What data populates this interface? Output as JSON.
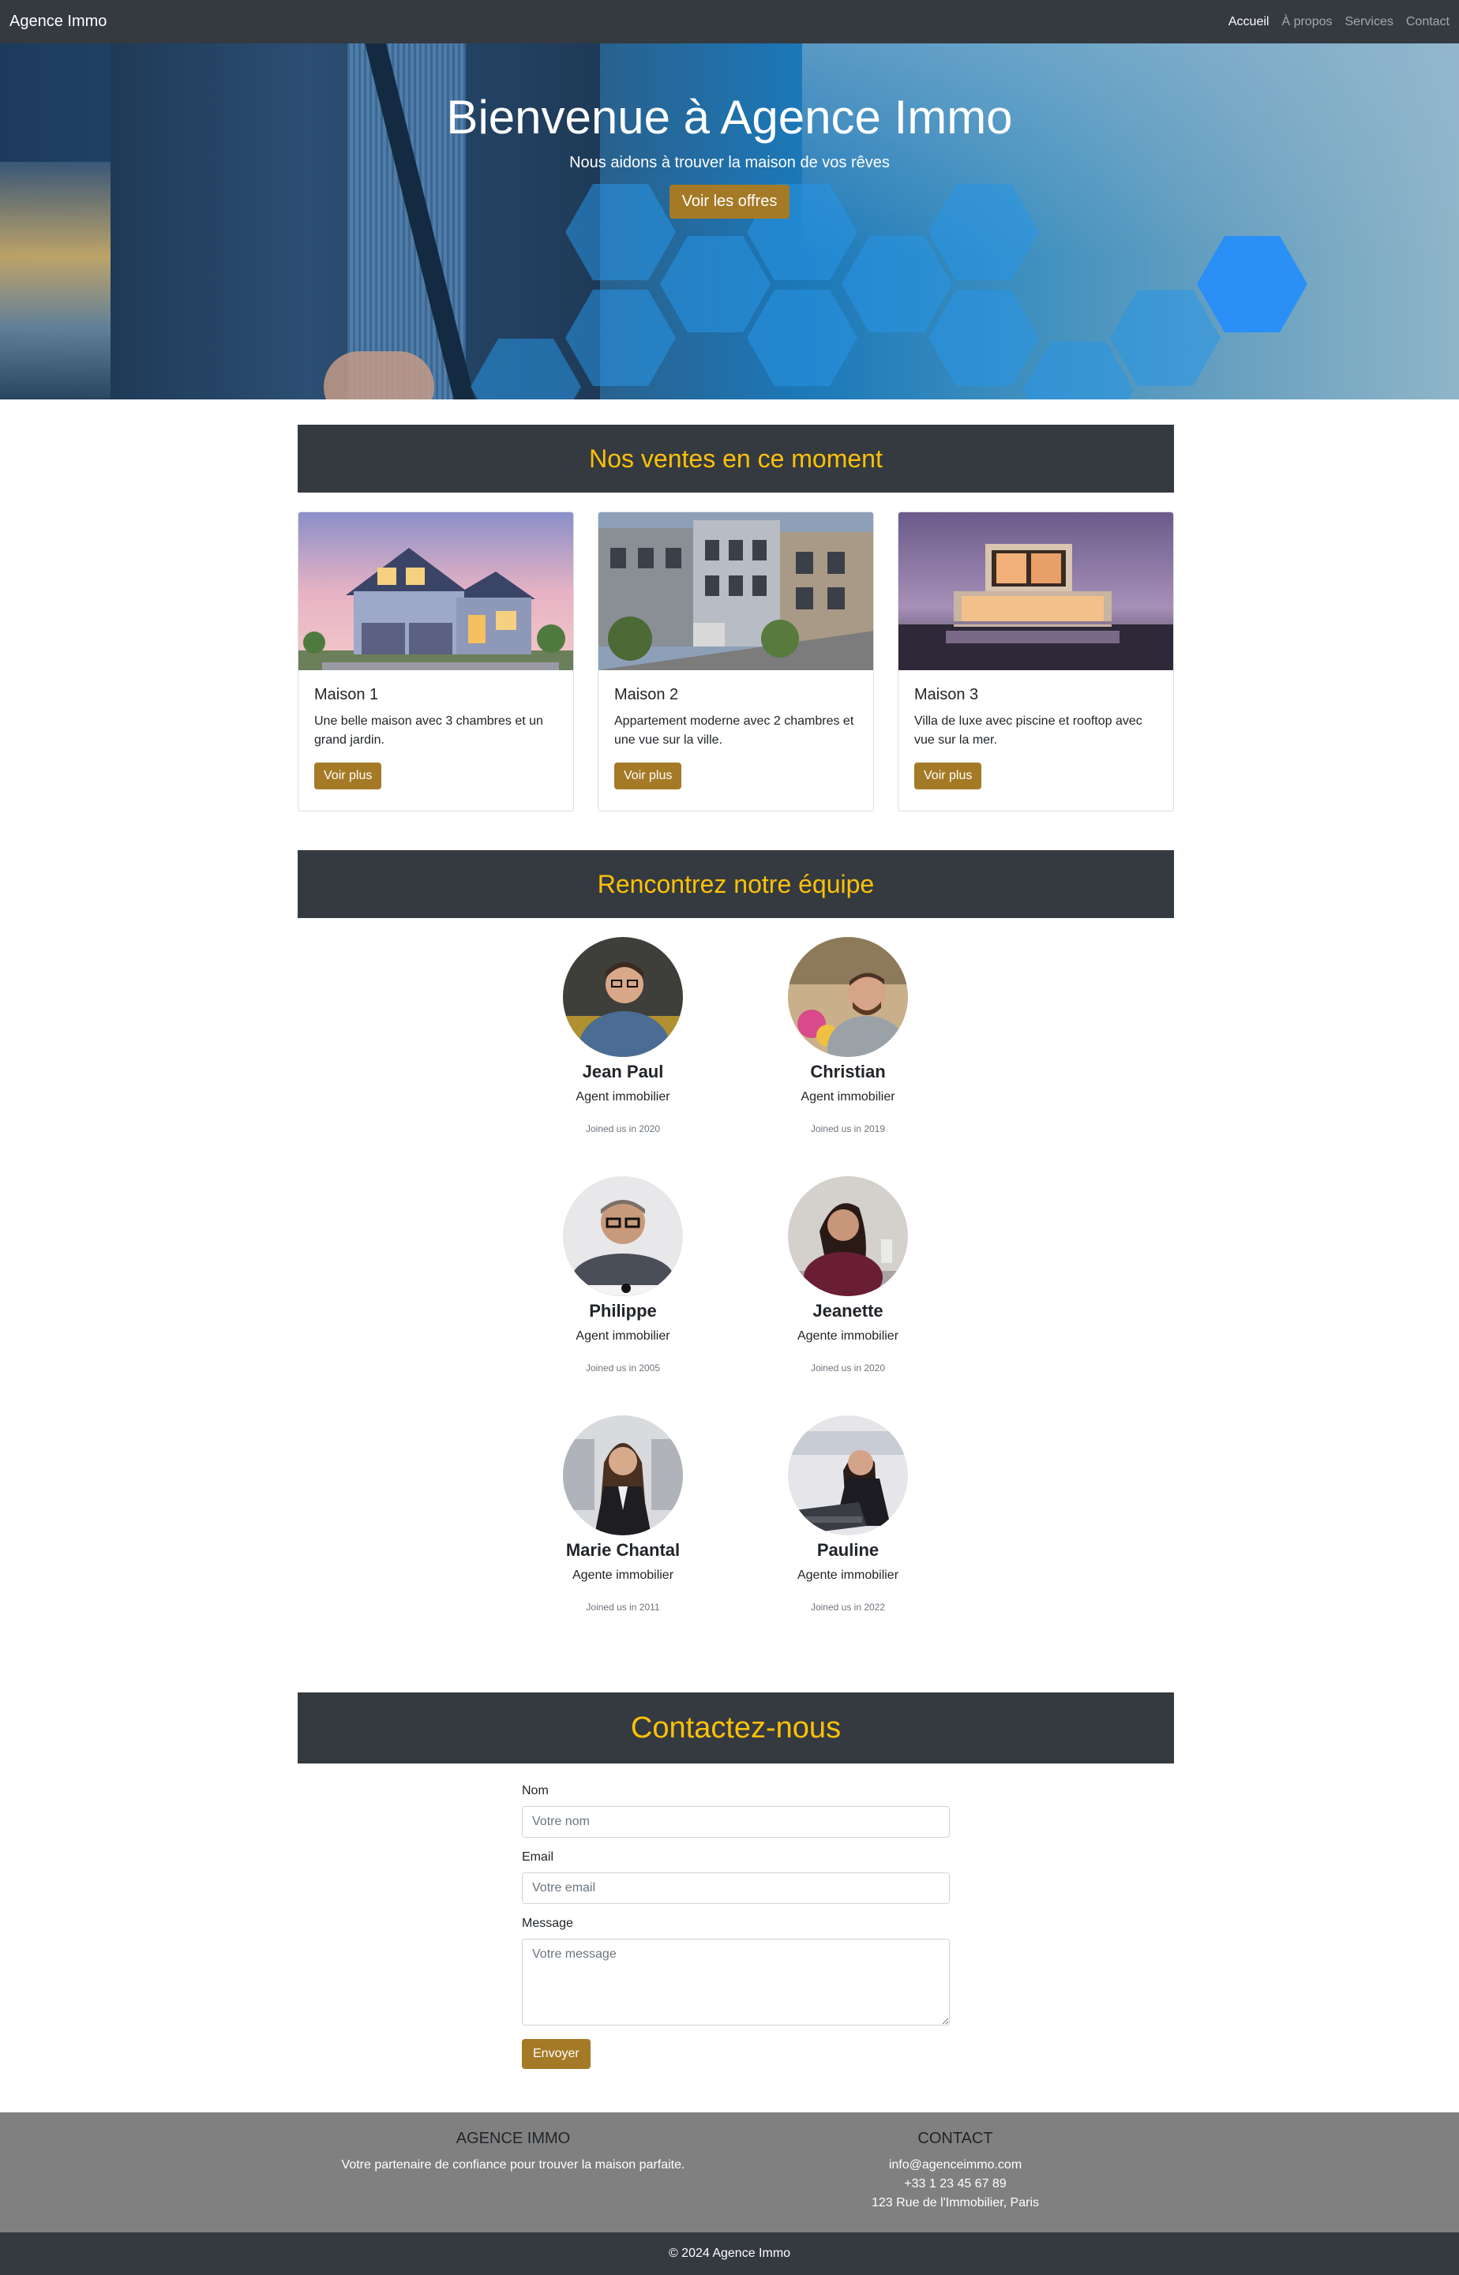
{
  "navbar": {
    "brand": "Agence Immo",
    "links": [
      {
        "label": "Accueil",
        "active": true
      },
      {
        "label": "À propos",
        "active": false
      },
      {
        "label": "Services",
        "active": false
      },
      {
        "label": "Contact",
        "active": false
      }
    ]
  },
  "hero": {
    "title": "Bienvenue à Agence Immo",
    "subtitle": "Nous aidons à trouver la maison de vos rêves",
    "button_label": "Voir les offres"
  },
  "listings": {
    "heading": "Nos ventes en ce moment",
    "cards": [
      {
        "title": "Maison 1",
        "text": "Une belle maison avec 3 chambres et un grand jardin.",
        "button": "Voir plus"
      },
      {
        "title": "Maison 2",
        "text": "Appartement moderne avec 2 chambres et une vue sur la ville.",
        "button": "Voir plus"
      },
      {
        "title": "Maison 3",
        "text": "Villa de luxe avec piscine et rooftop avec vue sur la mer.",
        "button": "Voir plus"
      }
    ]
  },
  "team": {
    "heading": "Rencontrez notre équipe",
    "members": [
      {
        "name": "Jean Paul",
        "role": "Agent immobilier",
        "joined": "Joined us in 2020"
      },
      {
        "name": "Christian",
        "role": "Agent immobilier",
        "joined": "Joined us in 2019"
      },
      {
        "name": "Philippe",
        "role": "Agent immobilier",
        "joined": "Joined us in 2005"
      },
      {
        "name": "Jeanette",
        "role": "Agente immobilier",
        "joined": "Joined us in 2020"
      },
      {
        "name": "Marie Chantal",
        "role": "Agente immobilier",
        "joined": "Joined us in 2011"
      },
      {
        "name": "Pauline",
        "role": "Agente immobilier",
        "joined": "Joined us in 2022"
      }
    ]
  },
  "contact": {
    "heading": "Contactez-nous",
    "name_label": "Nom",
    "name_placeholder": "Votre nom",
    "email_label": "Email",
    "email_placeholder": "Votre email",
    "message_label": "Message",
    "message_placeholder": "Votre message",
    "submit_label": "Envoyer"
  },
  "footer": {
    "about_title": "AGENCE IMMO",
    "about_text": "Votre partenaire de confiance pour trouver la maison parfaite.",
    "contact_title": "CONTACT",
    "email": "info@agenceimmo.com",
    "phone": "+33 1 23 45 67 89",
    "address": "123 Rue de l'Immobilier, Paris",
    "copyright": "© 2024 Agence Immo"
  },
  "colors": {
    "dark": "#343a40",
    "accent_gold": "#a57a26",
    "heading_yellow": "#ffc107",
    "footer_gray": "#808080"
  }
}
